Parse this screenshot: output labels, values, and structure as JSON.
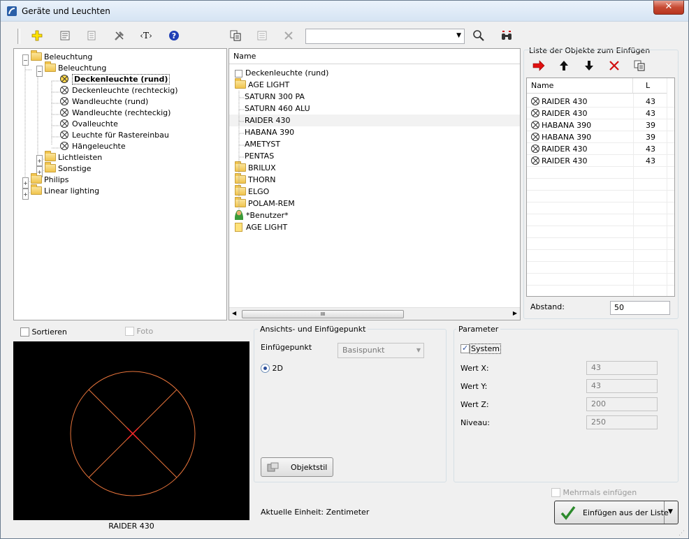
{
  "window": {
    "title": "Geräte und Leuchten",
    "close_label": "✕"
  },
  "toolbar": {
    "search_value": ""
  },
  "tree": [
    {
      "label": "Beleuchtung",
      "level": 0,
      "type": "folder",
      "expanded": true
    },
    {
      "label": "Beleuchtung",
      "level": 1,
      "type": "folder",
      "expanded": true
    },
    {
      "label": "Deckenleuchte (rund)",
      "level": 2,
      "type": "lamp",
      "selected": true
    },
    {
      "label": "Deckenleuchte (rechteckig)",
      "level": 2,
      "type": "lamp"
    },
    {
      "label": "Wandleuchte (rund)",
      "level": 2,
      "type": "lamp"
    },
    {
      "label": "Wandleuchte (rechteckig)",
      "level": 2,
      "type": "lamp"
    },
    {
      "label": "Ovalleuchte",
      "level": 2,
      "type": "lamp"
    },
    {
      "label": "Leuchte für Rastereinbau",
      "level": 2,
      "type": "lamp"
    },
    {
      "label": "Hängeleuchte",
      "level": 2,
      "type": "lamp"
    },
    {
      "label": "Lichtleisten",
      "level": 1,
      "type": "folder",
      "expanded": false
    },
    {
      "label": "Sonstige",
      "level": 1,
      "type": "folder",
      "expanded": false
    },
    {
      "label": "Philips",
      "level": 0,
      "type": "folder",
      "expanded": false
    },
    {
      "label": "Linear lighting",
      "level": 0,
      "type": "folder",
      "expanded": false
    }
  ],
  "list": {
    "header": "Name",
    "items": [
      {
        "label": "Deckenleuchte (rund)",
        "icon": "checkbox",
        "indent": 0
      },
      {
        "label": "AGE LIGHT",
        "icon": "open-folder",
        "indent": 0
      },
      {
        "label": "SATURN 300 PA",
        "icon": "none",
        "indent": 1
      },
      {
        "label": "SATURN 460 ALU",
        "icon": "none",
        "indent": 1
      },
      {
        "label": "RAIDER 430",
        "icon": "none",
        "indent": 1,
        "selected": true
      },
      {
        "label": "HABANA 390",
        "icon": "none",
        "indent": 1
      },
      {
        "label": "AMETYST",
        "icon": "none",
        "indent": 1
      },
      {
        "label": "PENTAS",
        "icon": "none",
        "indent": 1
      },
      {
        "label": "BRILUX",
        "icon": "folder",
        "indent": 0
      },
      {
        "label": "THORN",
        "icon": "folder",
        "indent": 0
      },
      {
        "label": "ELGO",
        "icon": "folder",
        "indent": 0
      },
      {
        "label": "POLAM-REM",
        "icon": "folder",
        "indent": 0
      },
      {
        "label": "*Benutzer*",
        "icon": "user",
        "indent": 0
      },
      {
        "label": "AGE LIGHT",
        "icon": "note",
        "indent": 0
      }
    ],
    "scroll_grip": "III"
  },
  "insert_list": {
    "title": "Liste der Objekte zum Einfügen",
    "col_name": "Name",
    "col_l": "L",
    "rows": [
      {
        "name": "RAIDER 430",
        "l": "43"
      },
      {
        "name": "RAIDER 430",
        "l": "43"
      },
      {
        "name": "HABANA 390",
        "l": "39"
      },
      {
        "name": "HABANA 390",
        "l": "39"
      },
      {
        "name": "RAIDER 430",
        "l": "43"
      },
      {
        "name": "RAIDER 430",
        "l": "43"
      }
    ],
    "abstand_label": "Abstand:",
    "abstand_value": "50"
  },
  "preview": {
    "sort_label": "Sortieren",
    "foto_label": "Foto",
    "caption": "RAIDER 430",
    "accent": "#e8743b",
    "cross": "#ff2a2a"
  },
  "view_group": {
    "title": "Ansichts- und Einfügepunkt",
    "insert_label": "Einfügepunkt",
    "insert_value": "Basispunkt",
    "radio_2d": "2D",
    "style_button": "Objektstil",
    "unit_text": "Aktuelle Einheit: Zentimeter"
  },
  "params": {
    "title": "Parameter",
    "system_label": "System",
    "fields": [
      {
        "label": "Wert X:",
        "value": "43"
      },
      {
        "label": "Wert Y:",
        "value": "43"
      },
      {
        "label": "Wert Z:",
        "value": "200"
      },
      {
        "label": "Niveau:",
        "value": "250"
      }
    ]
  },
  "footer": {
    "multi_label": "Mehrmals einfügen",
    "insert_button": "Einfügen aus der Liste",
    "dropdown_arrow": "▼"
  }
}
